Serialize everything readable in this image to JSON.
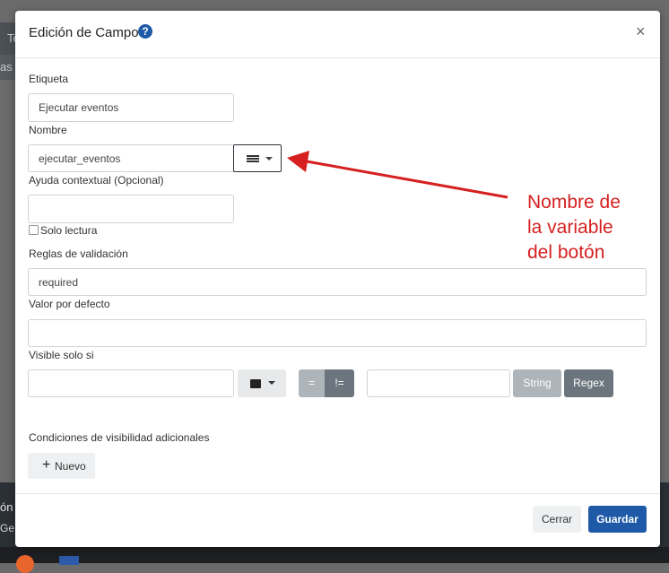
{
  "background": {
    "topbar_text": "Te",
    "side_text": "as",
    "bottom_text_1": "ón c",
    "bottom_text_2": "Ge"
  },
  "modal": {
    "title": "Edición de Campo",
    "help_icon": "question-icon",
    "close_label": "×",
    "fields": {
      "etiqueta_label": "Etiqueta",
      "etiqueta_value": "Ejecutar eventos",
      "nombre_label": "Nombre",
      "nombre_value": "ejecutar_eventos",
      "ayuda_label": "Ayuda contextual (Opcional)",
      "ayuda_value": "",
      "solo_lectura_label": "Solo lectura",
      "reglas_label": "Reglas de validación",
      "reglas_value": "required",
      "valor_label": "Valor por defecto",
      "valor_value": "",
      "visible_label": "Visible solo si",
      "visible_value": "",
      "compare_value": ""
    },
    "operators": {
      "equals": "=",
      "not_equals": "!="
    },
    "type_buttons": {
      "string": "String",
      "regex": "Regex"
    },
    "conditions_label": "Condiciones de visibilidad adicionales",
    "new_button": "Nuevo",
    "footer": {
      "cancel": "Cerrar",
      "save": "Guardar"
    },
    "colors": {
      "primary": "#1f5aa8",
      "annotation": "#d62020"
    }
  },
  "annotation": {
    "line1": "Nombre de",
    "line2": "la variable",
    "line3": "del botón"
  }
}
